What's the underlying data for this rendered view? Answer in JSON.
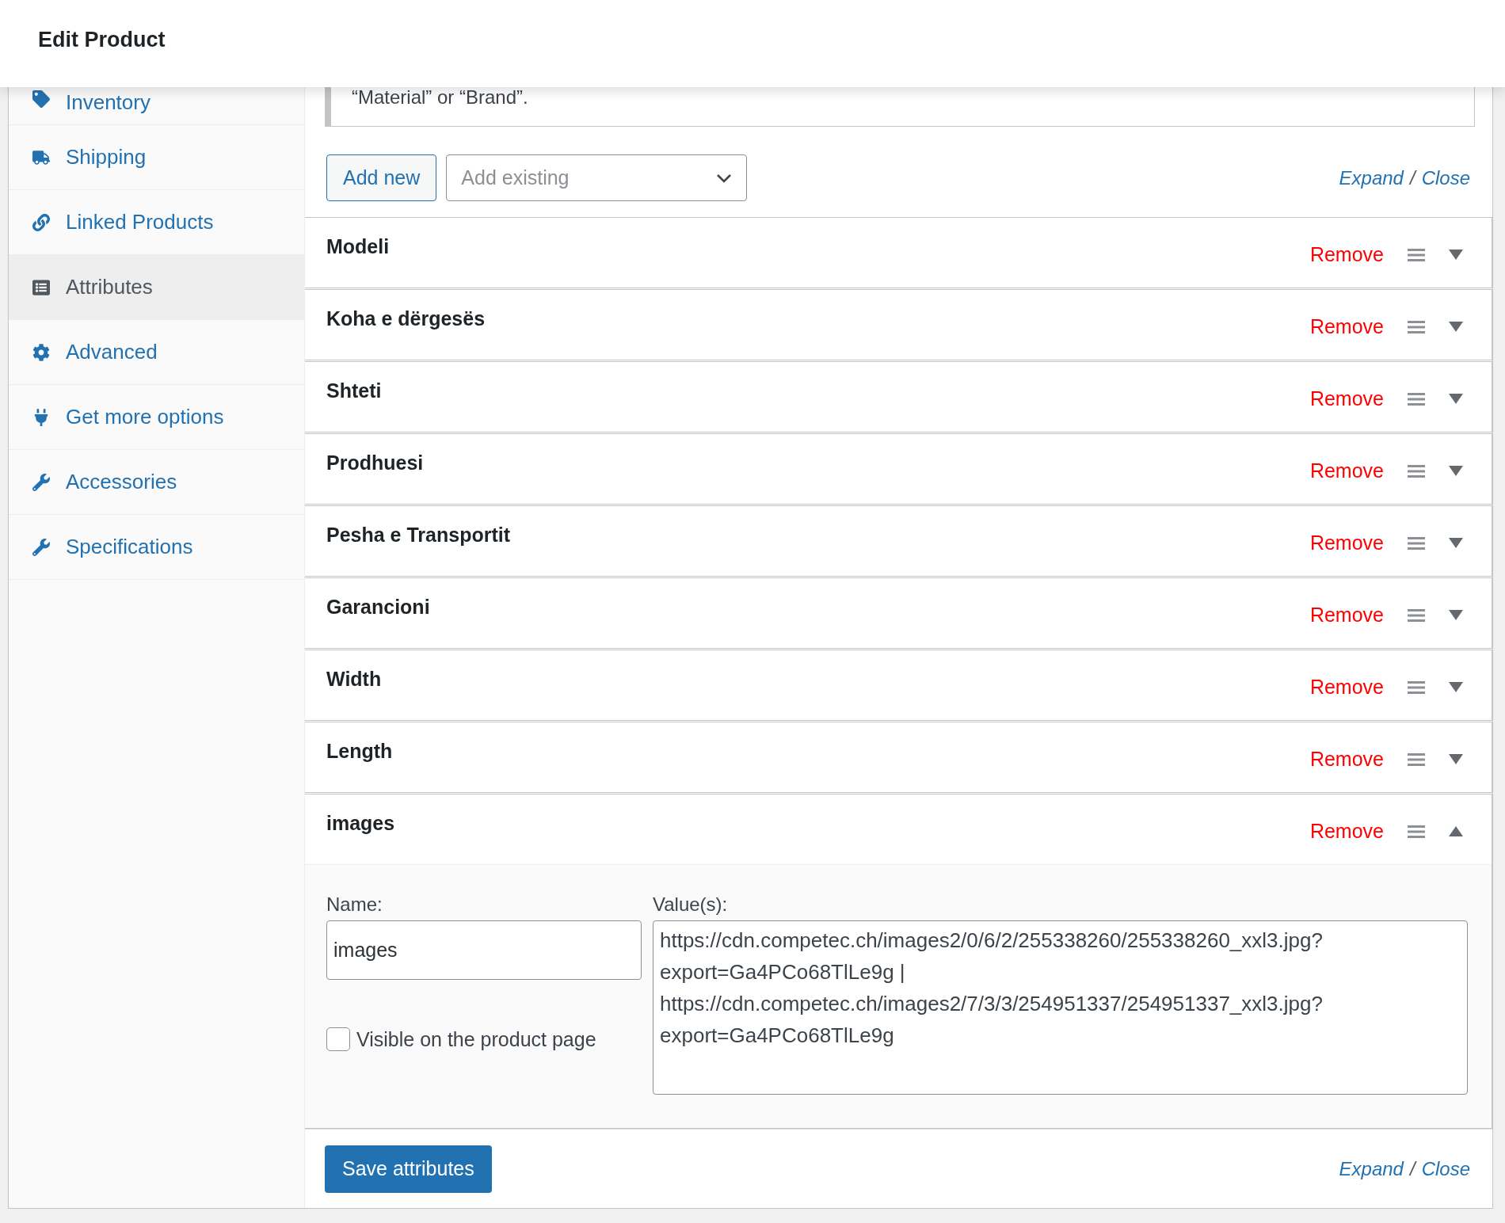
{
  "header": {
    "title": "Edit Product"
  },
  "sidebar": {
    "items": [
      {
        "label": "Inventory",
        "selected": false
      },
      {
        "label": "Shipping",
        "selected": false
      },
      {
        "label": "Linked Products",
        "selected": false
      },
      {
        "label": "Attributes",
        "selected": true
      },
      {
        "label": "Advanced",
        "selected": false
      },
      {
        "label": "Get more options",
        "selected": false
      },
      {
        "label": "Accessories",
        "selected": false
      },
      {
        "label": "Specifications",
        "selected": false
      }
    ]
  },
  "attributes": {
    "hint": "“Material” or “Brand”.",
    "toolbar": {
      "add_new": "Add new",
      "add_existing_placeholder": "Add existing",
      "expand": "Expand",
      "separator": "/",
      "close": "Close"
    },
    "rows": [
      {
        "name": "Modeli",
        "remove": "Remove",
        "expanded": false
      },
      {
        "name": "Koha e dërgesës",
        "remove": "Remove",
        "expanded": false
      },
      {
        "name": "Shteti",
        "remove": "Remove",
        "expanded": false
      },
      {
        "name": "Prodhuesi",
        "remove": "Remove",
        "expanded": false
      },
      {
        "name": "Pesha e Transportit",
        "remove": "Remove",
        "expanded": false
      },
      {
        "name": "Garancioni",
        "remove": "Remove",
        "expanded": false
      },
      {
        "name": "Width",
        "remove": "Remove",
        "expanded": false
      },
      {
        "name": "Length",
        "remove": "Remove",
        "expanded": false
      },
      {
        "name": "images",
        "remove": "Remove",
        "expanded": true,
        "details": {
          "name_label": "Name:",
          "name_value": "images",
          "visible_label": "Visible on the product page",
          "visible_checked": false,
          "values_label": "Value(s):",
          "values": "https://cdn.competec.ch/images2/0/6/2/255338260/255338260_xxl3.jpg?export=Ga4PCo68TlLe9g | https://cdn.competec.ch/images2/7/3/3/254951337/254951337_xxl3.jpg?export=Ga4PCo68TlLe9g"
        }
      }
    ],
    "footer": {
      "save": "Save attributes",
      "expand": "Expand",
      "separator": "/",
      "close": "Close"
    }
  }
}
